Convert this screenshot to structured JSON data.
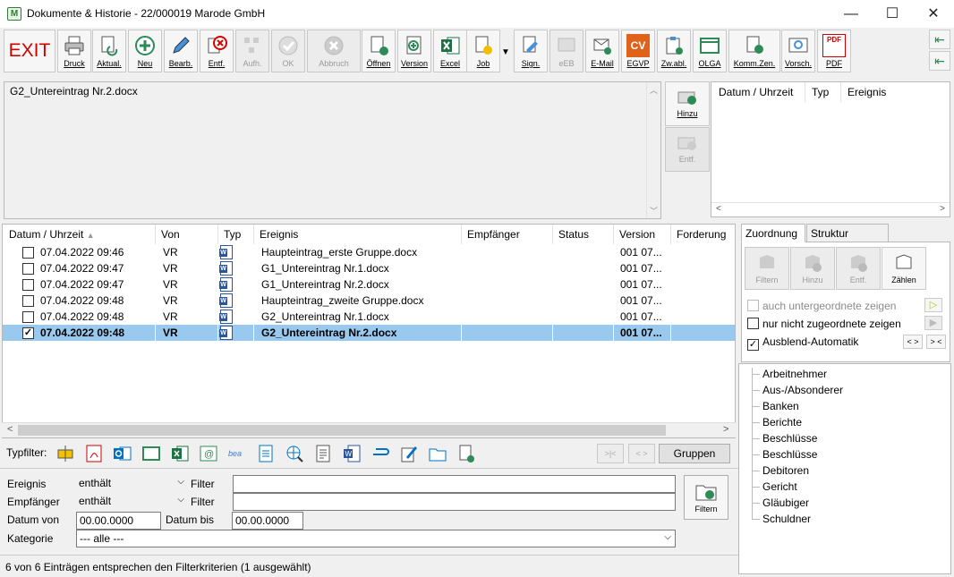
{
  "window": {
    "title": "Dokumente & Historie - 22/000019 Marode GmbH",
    "minimize": "—",
    "maximize": "☐",
    "close": "✕",
    "app_icon": "M"
  },
  "toolbar": {
    "exit": "EXIT",
    "buttons": [
      {
        "label": "Druck",
        "icon": "printer-icon"
      },
      {
        "label": "Aktual.",
        "icon": "refresh-icon"
      },
      {
        "label": "Neu",
        "icon": "new-icon"
      },
      {
        "label": "Bearb.",
        "icon": "edit-icon"
      },
      {
        "label": "Entf.",
        "icon": "delete-icon"
      },
      {
        "label": "Aufh.",
        "icon": "split-icon"
      },
      {
        "label": "OK",
        "icon": "ok-icon"
      },
      {
        "label": "Abbruch",
        "icon": "cancel-icon"
      },
      {
        "label": "Öffnen",
        "icon": "open-icon"
      },
      {
        "label": "Version",
        "icon": "version-icon"
      },
      {
        "label": "Excel",
        "icon": "excel-icon"
      },
      {
        "label": "Job",
        "icon": "job-icon"
      },
      {
        "label": "Sign.",
        "icon": "sign-icon"
      },
      {
        "label": "eEB",
        "icon": "eeb-icon"
      },
      {
        "label": "E-Mail",
        "icon": "email-icon"
      },
      {
        "label": "EGVP",
        "icon": "egvp-icon"
      },
      {
        "label": "Zw.abl.",
        "icon": "clipboard-icon"
      },
      {
        "label": "OLGA",
        "icon": "olga-icon"
      },
      {
        "label": "Komm.Zen.",
        "icon": "comm-icon"
      },
      {
        "label": "Vorsch.",
        "icon": "preview-icon"
      },
      {
        "label": "PDF",
        "icon": "pdf-icon"
      }
    ],
    "egvp_badge": "CV",
    "pdf_badge": "PDF"
  },
  "preview": {
    "text": "G2_Untereintrag Nr.2.docx"
  },
  "side_buttons": {
    "add": "Hinzu",
    "remove": "Entf."
  },
  "history_small": {
    "columns": [
      "Datum / Uhrzeit",
      "Typ",
      "Ereignis"
    ]
  },
  "table": {
    "columns": [
      "Datum / Uhrzeit",
      "Von",
      "Typ",
      "Ereignis",
      "Empfänger",
      "Status",
      "Version",
      "Forderung"
    ],
    "rows": [
      {
        "date": "07.04.2022  09:46",
        "von": "VR",
        "ereignis": "Haupteintrag_erste Gruppe.docx",
        "version": "001  07...",
        "checked": false,
        "selected": false
      },
      {
        "date": "07.04.2022  09:47",
        "von": "VR",
        "ereignis": "G1_Untereintrag Nr.1.docx",
        "version": "001  07...",
        "checked": false,
        "selected": false
      },
      {
        "date": "07.04.2022  09:47",
        "von": "VR",
        "ereignis": "G1_Untereintrag Nr.2.docx",
        "version": "001  07...",
        "checked": false,
        "selected": false
      },
      {
        "date": "07.04.2022  09:48",
        "von": "VR",
        "ereignis": "Haupteintrag_zweite Gruppe.docx",
        "version": "001  07...",
        "checked": false,
        "selected": false
      },
      {
        "date": "07.04.2022  09:48",
        "von": "VR",
        "ereignis": "G2_Untereintrag Nr.1.docx",
        "version": "001  07...",
        "checked": false,
        "selected": false
      },
      {
        "date": "07.04.2022  09:48",
        "von": "VR",
        "ereignis": "G2_Untereintrag Nr.2.docx",
        "version": "001  07...",
        "checked": true,
        "selected": true
      }
    ]
  },
  "typfilter": {
    "label": "Typfilter:",
    "gruppen": "Gruppen",
    "nav_prev": ">|<",
    "nav_next": "< >"
  },
  "filter": {
    "ereignis_label": "Ereignis",
    "ereignis_value": "enthält",
    "empfaenger_label": "Empfänger",
    "empfaenger_value": "enthält",
    "filter_label": "Filter",
    "datum_von_label": "Datum von",
    "datum_von_value": "00.00.0000",
    "datum_bis_label": "Datum bis",
    "datum_bis_value": "00.00.0000",
    "kategorie_label": "Kategorie",
    "kategorie_value": "--- alle ---",
    "filter_button": "Filtern"
  },
  "status": {
    "text": "6 von 6 Einträgen entsprechen den Filterkriterien (1 ausgewählt)"
  },
  "tabs": {
    "zuordnung": "Zuordnung",
    "struktur": "Struktur ändern",
    "buttons": [
      "Filtern",
      "Hinzu",
      "Entf.",
      "Zählen"
    ],
    "opt1": "auch untergeordnete zeigen",
    "opt2": "nur nicht zugeordnete zeigen",
    "opt3": "Ausblend-Automatik",
    "btn_lt": "< >",
    "btn_gt": "> <"
  },
  "tree": {
    "items": [
      "Arbeitnehmer",
      "Aus-/Absonderer",
      "Banken",
      "Berichte",
      "Beschlüsse",
      "Beschlüsse",
      "Debitoren",
      "Gericht",
      "Gläubiger",
      "Schuldner"
    ]
  },
  "colors": {
    "selection": "#99c9ef",
    "exit_red": "#d10000",
    "excel_green": "#1e7145",
    "word_blue": "#2b579a",
    "egvp_orange": "#e0621a"
  }
}
